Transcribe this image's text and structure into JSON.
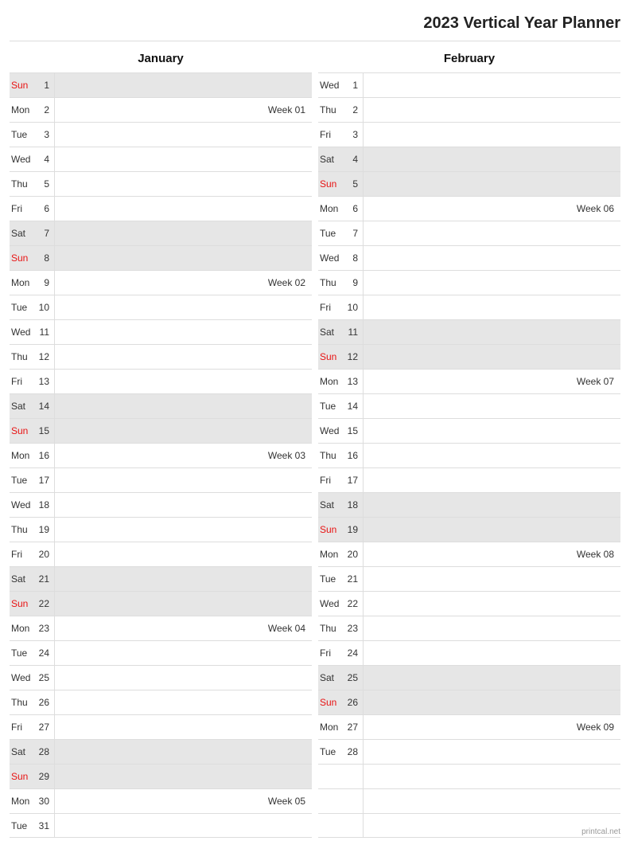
{
  "title": "2023 Vertical Year Planner",
  "footer": "printcal.net",
  "months": [
    {
      "name": "January",
      "days": [
        {
          "dow": "Sun",
          "num": "1",
          "shaded": true,
          "sunday": true,
          "note": ""
        },
        {
          "dow": "Mon",
          "num": "2",
          "shaded": false,
          "sunday": false,
          "note": "Week 01"
        },
        {
          "dow": "Tue",
          "num": "3",
          "shaded": false,
          "sunday": false,
          "note": ""
        },
        {
          "dow": "Wed",
          "num": "4",
          "shaded": false,
          "sunday": false,
          "note": ""
        },
        {
          "dow": "Thu",
          "num": "5",
          "shaded": false,
          "sunday": false,
          "note": ""
        },
        {
          "dow": "Fri",
          "num": "6",
          "shaded": false,
          "sunday": false,
          "note": ""
        },
        {
          "dow": "Sat",
          "num": "7",
          "shaded": true,
          "sunday": false,
          "note": ""
        },
        {
          "dow": "Sun",
          "num": "8",
          "shaded": true,
          "sunday": true,
          "note": ""
        },
        {
          "dow": "Mon",
          "num": "9",
          "shaded": false,
          "sunday": false,
          "note": "Week 02"
        },
        {
          "dow": "Tue",
          "num": "10",
          "shaded": false,
          "sunday": false,
          "note": ""
        },
        {
          "dow": "Wed",
          "num": "11",
          "shaded": false,
          "sunday": false,
          "note": ""
        },
        {
          "dow": "Thu",
          "num": "12",
          "shaded": false,
          "sunday": false,
          "note": ""
        },
        {
          "dow": "Fri",
          "num": "13",
          "shaded": false,
          "sunday": false,
          "note": ""
        },
        {
          "dow": "Sat",
          "num": "14",
          "shaded": true,
          "sunday": false,
          "note": ""
        },
        {
          "dow": "Sun",
          "num": "15",
          "shaded": true,
          "sunday": true,
          "note": ""
        },
        {
          "dow": "Mon",
          "num": "16",
          "shaded": false,
          "sunday": false,
          "note": "Week 03"
        },
        {
          "dow": "Tue",
          "num": "17",
          "shaded": false,
          "sunday": false,
          "note": ""
        },
        {
          "dow": "Wed",
          "num": "18",
          "shaded": false,
          "sunday": false,
          "note": ""
        },
        {
          "dow": "Thu",
          "num": "19",
          "shaded": false,
          "sunday": false,
          "note": ""
        },
        {
          "dow": "Fri",
          "num": "20",
          "shaded": false,
          "sunday": false,
          "note": ""
        },
        {
          "dow": "Sat",
          "num": "21",
          "shaded": true,
          "sunday": false,
          "note": ""
        },
        {
          "dow": "Sun",
          "num": "22",
          "shaded": true,
          "sunday": true,
          "note": ""
        },
        {
          "dow": "Mon",
          "num": "23",
          "shaded": false,
          "sunday": false,
          "note": "Week 04"
        },
        {
          "dow": "Tue",
          "num": "24",
          "shaded": false,
          "sunday": false,
          "note": ""
        },
        {
          "dow": "Wed",
          "num": "25",
          "shaded": false,
          "sunday": false,
          "note": ""
        },
        {
          "dow": "Thu",
          "num": "26",
          "shaded": false,
          "sunday": false,
          "note": ""
        },
        {
          "dow": "Fri",
          "num": "27",
          "shaded": false,
          "sunday": false,
          "note": ""
        },
        {
          "dow": "Sat",
          "num": "28",
          "shaded": true,
          "sunday": false,
          "note": ""
        },
        {
          "dow": "Sun",
          "num": "29",
          "shaded": true,
          "sunday": true,
          "note": ""
        },
        {
          "dow": "Mon",
          "num": "30",
          "shaded": false,
          "sunday": false,
          "note": "Week 05"
        },
        {
          "dow": "Tue",
          "num": "31",
          "shaded": false,
          "sunday": false,
          "note": ""
        }
      ]
    },
    {
      "name": "February",
      "days": [
        {
          "dow": "Wed",
          "num": "1",
          "shaded": false,
          "sunday": false,
          "note": ""
        },
        {
          "dow": "Thu",
          "num": "2",
          "shaded": false,
          "sunday": false,
          "note": ""
        },
        {
          "dow": "Fri",
          "num": "3",
          "shaded": false,
          "sunday": false,
          "note": ""
        },
        {
          "dow": "Sat",
          "num": "4",
          "shaded": true,
          "sunday": false,
          "note": ""
        },
        {
          "dow": "Sun",
          "num": "5",
          "shaded": true,
          "sunday": true,
          "note": ""
        },
        {
          "dow": "Mon",
          "num": "6",
          "shaded": false,
          "sunday": false,
          "note": "Week 06"
        },
        {
          "dow": "Tue",
          "num": "7",
          "shaded": false,
          "sunday": false,
          "note": ""
        },
        {
          "dow": "Wed",
          "num": "8",
          "shaded": false,
          "sunday": false,
          "note": ""
        },
        {
          "dow": "Thu",
          "num": "9",
          "shaded": false,
          "sunday": false,
          "note": ""
        },
        {
          "dow": "Fri",
          "num": "10",
          "shaded": false,
          "sunday": false,
          "note": ""
        },
        {
          "dow": "Sat",
          "num": "11",
          "shaded": true,
          "sunday": false,
          "note": ""
        },
        {
          "dow": "Sun",
          "num": "12",
          "shaded": true,
          "sunday": true,
          "note": ""
        },
        {
          "dow": "Mon",
          "num": "13",
          "shaded": false,
          "sunday": false,
          "note": "Week 07"
        },
        {
          "dow": "Tue",
          "num": "14",
          "shaded": false,
          "sunday": false,
          "note": ""
        },
        {
          "dow": "Wed",
          "num": "15",
          "shaded": false,
          "sunday": false,
          "note": ""
        },
        {
          "dow": "Thu",
          "num": "16",
          "shaded": false,
          "sunday": false,
          "note": ""
        },
        {
          "dow": "Fri",
          "num": "17",
          "shaded": false,
          "sunday": false,
          "note": ""
        },
        {
          "dow": "Sat",
          "num": "18",
          "shaded": true,
          "sunday": false,
          "note": ""
        },
        {
          "dow": "Sun",
          "num": "19",
          "shaded": true,
          "sunday": true,
          "note": ""
        },
        {
          "dow": "Mon",
          "num": "20",
          "shaded": false,
          "sunday": false,
          "note": "Week 08"
        },
        {
          "dow": "Tue",
          "num": "21",
          "shaded": false,
          "sunday": false,
          "note": ""
        },
        {
          "dow": "Wed",
          "num": "22",
          "shaded": false,
          "sunday": false,
          "note": ""
        },
        {
          "dow": "Thu",
          "num": "23",
          "shaded": false,
          "sunday": false,
          "note": ""
        },
        {
          "dow": "Fri",
          "num": "24",
          "shaded": false,
          "sunday": false,
          "note": ""
        },
        {
          "dow": "Sat",
          "num": "25",
          "shaded": true,
          "sunday": false,
          "note": ""
        },
        {
          "dow": "Sun",
          "num": "26",
          "shaded": true,
          "sunday": true,
          "note": ""
        },
        {
          "dow": "Mon",
          "num": "27",
          "shaded": false,
          "sunday": false,
          "note": "Week 09"
        },
        {
          "dow": "Tue",
          "num": "28",
          "shaded": false,
          "sunday": false,
          "note": ""
        },
        {
          "dow": "",
          "num": "",
          "shaded": false,
          "sunday": false,
          "note": ""
        },
        {
          "dow": "",
          "num": "",
          "shaded": false,
          "sunday": false,
          "note": ""
        },
        {
          "dow": "",
          "num": "",
          "shaded": false,
          "sunday": false,
          "note": ""
        }
      ]
    }
  ]
}
